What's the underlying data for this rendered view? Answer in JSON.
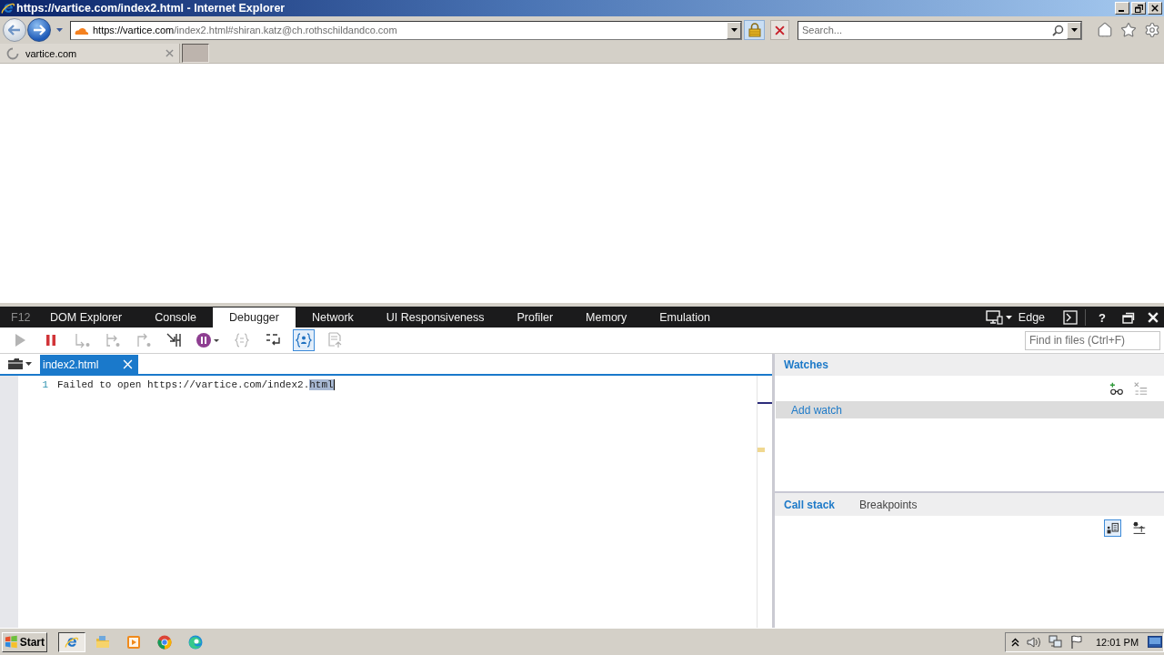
{
  "window": {
    "title": "https://vartice.com/index2.html - Internet Explorer"
  },
  "address": {
    "host": "https://vartice.com",
    "path": "/index2.html#shiran.katz@ch.rothschildandco.com"
  },
  "search": {
    "placeholder": "Search..."
  },
  "browser_tabs": [
    {
      "label": "vartice.com",
      "loading": true
    }
  ],
  "devtools": {
    "label": "F12",
    "tabs": [
      {
        "label": "DOM Explorer",
        "selected": false
      },
      {
        "label": "Console",
        "selected": false
      },
      {
        "label": "Debugger",
        "selected": true
      },
      {
        "label": "Network",
        "selected": false
      },
      {
        "label": "UI Responsiveness",
        "selected": false
      },
      {
        "label": "Profiler",
        "selected": false
      },
      {
        "label": "Memory",
        "selected": false
      },
      {
        "label": "Emulation",
        "selected": false
      }
    ],
    "browser_mode": "Edge",
    "help": "?",
    "toolbar": [
      {
        "kind": "continue",
        "disabled": true,
        "on": false
      },
      {
        "kind": "break",
        "disabled": false,
        "on": false
      },
      {
        "kind": "step-into",
        "disabled": true,
        "on": false
      },
      {
        "kind": "step-over",
        "disabled": true,
        "on": false
      },
      {
        "kind": "step-out",
        "disabled": true,
        "on": false
      },
      {
        "kind": "new-worker",
        "disabled": false,
        "on": false
      },
      {
        "kind": "exceptions",
        "disabled": false,
        "on": false
      },
      {
        "kind": "pretty-print",
        "disabled": true,
        "on": false
      },
      {
        "kind": "word-wrap",
        "disabled": false,
        "on": false
      },
      {
        "kind": "just-my-code",
        "disabled": false,
        "on": true
      },
      {
        "kind": "source-maps",
        "disabled": true,
        "on": false
      }
    ],
    "find": {
      "placeholder": "Find in files (Ctrl+F)"
    },
    "files": [
      {
        "label": "index2.html",
        "selected": true
      }
    ],
    "code_lines": [
      {
        "number": "1",
        "text": "Failed to open https://vartice.com/index2.",
        "selected_text": "html"
      }
    ],
    "watches": {
      "title": "Watches",
      "add_label": "Add watch",
      "tools": [
        {
          "kind": "add",
          "disabled": false
        },
        {
          "kind": "delete-all",
          "disabled": true
        }
      ]
    },
    "call_stack": {
      "tabs": [
        {
          "label": "Call stack",
          "selected": true
        },
        {
          "label": "Breakpoints",
          "selected": false
        }
      ],
      "tools": [
        {
          "kind": "frames",
          "on": true
        },
        {
          "kind": "async",
          "on": false
        }
      ]
    }
  },
  "taskbar": {
    "start": "Start",
    "apps": [
      {
        "kind": "ie",
        "selected": true
      },
      {
        "kind": "files",
        "selected": false
      },
      {
        "kind": "player",
        "selected": false
      },
      {
        "kind": "chrome",
        "selected": false
      },
      {
        "kind": "edge",
        "selected": false
      }
    ],
    "clock": "12:01 PM"
  }
}
